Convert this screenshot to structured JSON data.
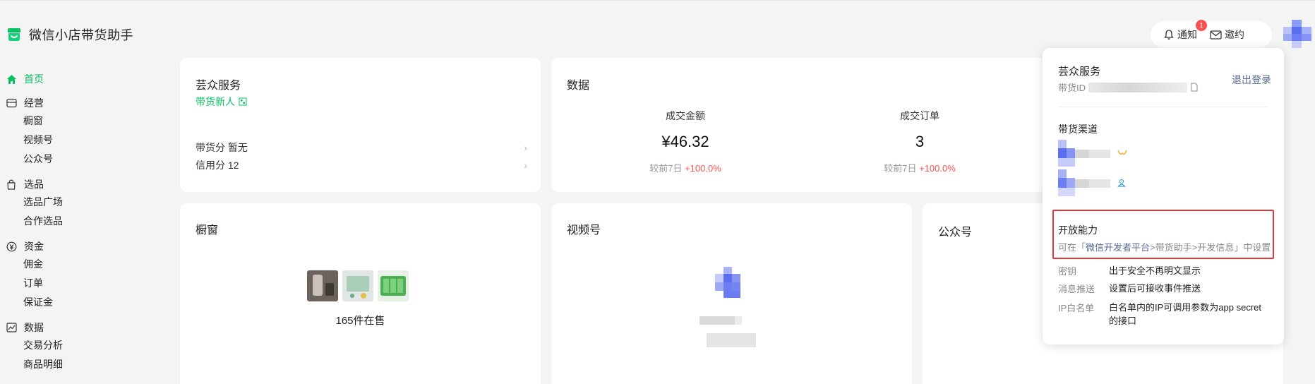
{
  "app": {
    "title": "微信小店带货助手"
  },
  "header": {
    "notify_label": "通知",
    "notify_badge": "1",
    "invite_label": "邀约"
  },
  "sidebar": {
    "home": "首页",
    "groups": [
      {
        "label": "经营",
        "icon": "store-icon",
        "items": [
          "橱窗",
          "视频号",
          "公众号"
        ]
      },
      {
        "label": "选品",
        "icon": "bag-icon",
        "items": [
          "选品广场",
          "合作选品"
        ]
      },
      {
        "label": "资金",
        "icon": "yen-icon",
        "items": [
          "佣金",
          "订单",
          "保证金"
        ]
      },
      {
        "label": "数据",
        "icon": "chart-icon",
        "items": [
          "交易分析",
          "商品明细"
        ]
      }
    ]
  },
  "yunzhong_card": {
    "title": "芸众服务",
    "tag": "带货新人",
    "score_row": "带货分 暂无",
    "credit_row": "信用分 12"
  },
  "data_card": {
    "title": "数据",
    "metrics": [
      {
        "label": "成交金额",
        "value": "¥46.32",
        "compare_prefix": "较前7日",
        "compare_value": "+100.0%"
      },
      {
        "label": "成交订单",
        "value": "3",
        "compare_prefix": "较前7日",
        "compare_value": "+100.0%"
      }
    ]
  },
  "showcase_card": {
    "title": "橱窗",
    "on_sale": "165件在售"
  },
  "video_card": {
    "title": "视频号"
  },
  "gzh_card": {
    "title": "公众号"
  },
  "popover": {
    "name": "芸众服务",
    "id_label": "带货ID",
    "logout": "退出登录",
    "channels_title": "带货渠道",
    "open_title": "开放能力",
    "open_desc_prefix": "可在「",
    "open_desc_link": "微信开发者平台",
    "open_desc_suffix": ">带货助手>开发信息」中设置",
    "fields": [
      {
        "key": "密钥",
        "value": "出于安全不再明文显示"
      },
      {
        "key": "消息推送",
        "value": "设置后可接收事件推送"
      },
      {
        "key": "IP白名单",
        "value": "白名单内的IP可调用参数为app secret的接口"
      }
    ]
  },
  "colors": {
    "brand": "#07c160",
    "link": "#576b95",
    "up": "#fa5151",
    "highlight_border": "#e53935"
  }
}
